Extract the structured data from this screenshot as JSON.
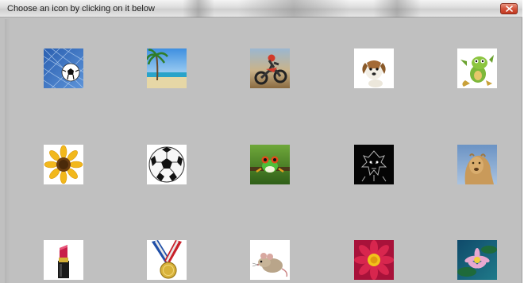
{
  "window": {
    "title": "Choose an icon by clicking on it below",
    "close_label": "close"
  },
  "icons": [
    {
      "name": "soccer-net-icon"
    },
    {
      "name": "beach-palm-icon"
    },
    {
      "name": "dirt-bike-icon"
    },
    {
      "name": "dog-icon"
    },
    {
      "name": "dragon-icon"
    },
    {
      "name": "sunflower-icon"
    },
    {
      "name": "soccer-ball-icon"
    },
    {
      "name": "frog-icon"
    },
    {
      "name": "dark-creature-icon"
    },
    {
      "name": "lioness-icon"
    },
    {
      "name": "lipstick-icon"
    },
    {
      "name": "medal-icon"
    },
    {
      "name": "mouse-icon"
    },
    {
      "name": "red-flower-icon"
    },
    {
      "name": "water-lily-icon"
    }
  ]
}
